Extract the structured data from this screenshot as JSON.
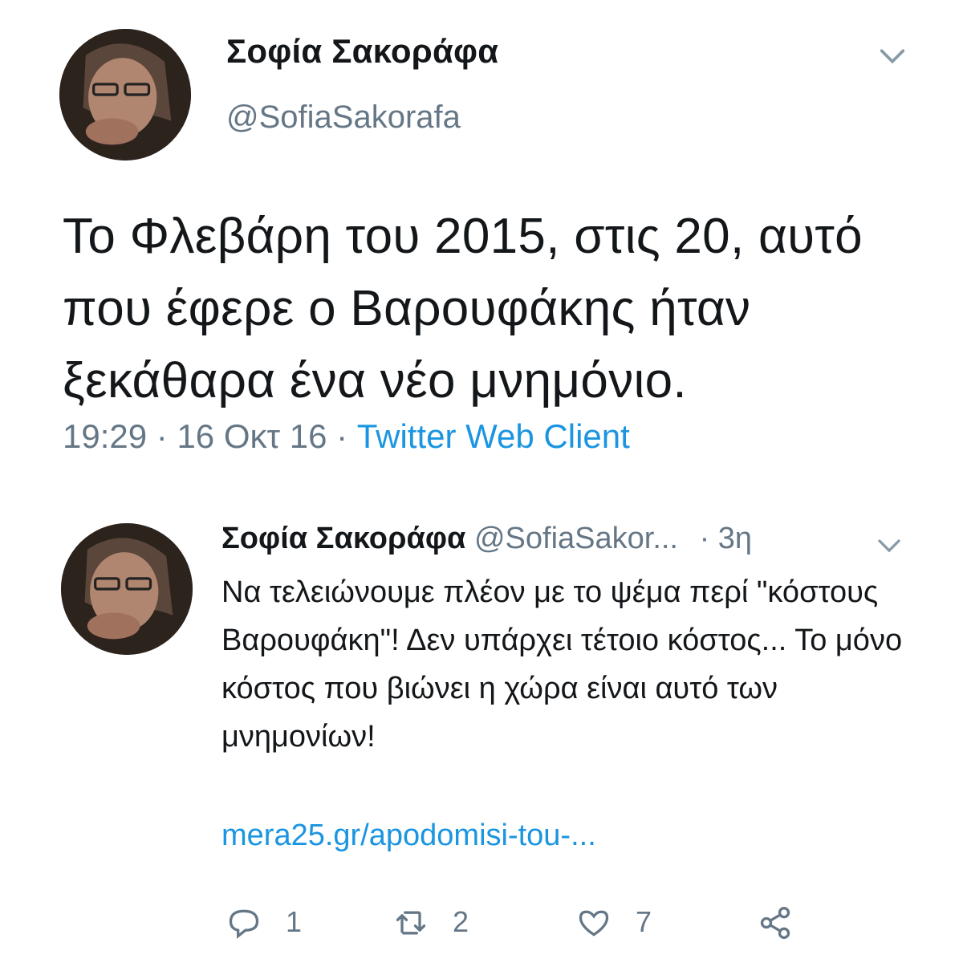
{
  "main_tweet": {
    "author_name": "Σοφία Σακοράφα",
    "author_handle": "@SofiaSakorafa",
    "text": "Το Φλεβάρη του 2015, στις 20, αυτό που έφερε ο Βαρουφάκης ήταν ξεκάθαρα ένα νέο μνημόνιο.",
    "time": "19:29",
    "date": "16 Οκτ 16",
    "source": "Twitter Web Client",
    "separator": " · "
  },
  "reply_tweet": {
    "author_name": "Σοφία Σακοράφα",
    "author_handle": "@SofiaSakor...",
    "age": "· 3η",
    "text": "Να τελειώνουμε πλέον με το ψέμα περί \"κόστους Βαρουφάκη\"! Δεν υπάρχει τέτοιο κόστος... Το μόνο κόστος που βιώνει η χώρα είναι αυτό των μνημονίων!",
    "link": "mera25.gr/apodomisi-tou-...",
    "actions": {
      "reply_count": "1",
      "retweet_count": "2",
      "like_count": "7"
    }
  },
  "colors": {
    "text": "#14171a",
    "secondary": "#657786",
    "link": "#1b95e0"
  },
  "icons": [
    "chevron-down-icon",
    "reply-icon",
    "retweet-icon",
    "like-icon",
    "share-icon"
  ]
}
